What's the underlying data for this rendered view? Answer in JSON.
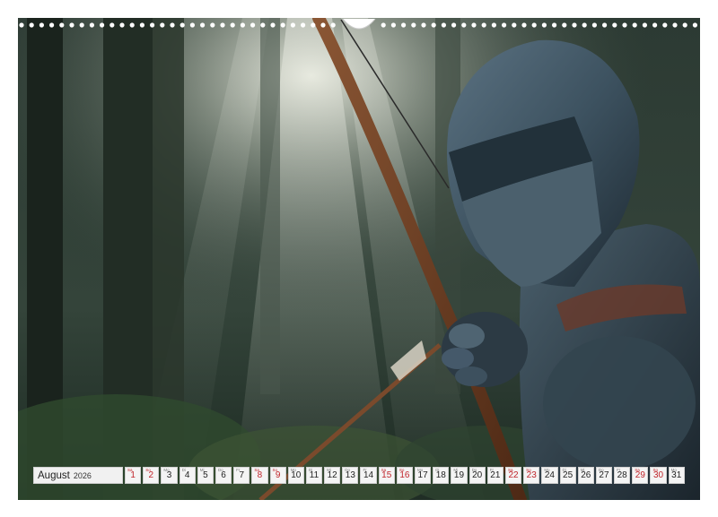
{
  "calendar": {
    "month": "August",
    "year": "2026",
    "weekend_color": "#c0262c",
    "days": [
      {
        "n": "1",
        "wd": "Sa",
        "weekend": true
      },
      {
        "n": "2",
        "wd": "So",
        "weekend": true
      },
      {
        "n": "3",
        "wd": "Mo",
        "weekend": false
      },
      {
        "n": "4",
        "wd": "Di",
        "weekend": false
      },
      {
        "n": "5",
        "wd": "Mi",
        "weekend": false
      },
      {
        "n": "6",
        "wd": "Do",
        "weekend": false
      },
      {
        "n": "7",
        "wd": "Fr",
        "weekend": false
      },
      {
        "n": "8",
        "wd": "Sa",
        "weekend": true
      },
      {
        "n": "9",
        "wd": "So",
        "weekend": true
      },
      {
        "n": "10",
        "wd": "Mo",
        "weekend": false
      },
      {
        "n": "11",
        "wd": "Di",
        "weekend": false
      },
      {
        "n": "12",
        "wd": "Mi",
        "weekend": false
      },
      {
        "n": "13",
        "wd": "Do",
        "weekend": false
      },
      {
        "n": "14",
        "wd": "Fr",
        "weekend": false
      },
      {
        "n": "15",
        "wd": "Sa",
        "weekend": true
      },
      {
        "n": "16",
        "wd": "So",
        "weekend": true
      },
      {
        "n": "17",
        "wd": "Mo",
        "weekend": false
      },
      {
        "n": "18",
        "wd": "Di",
        "weekend": false
      },
      {
        "n": "19",
        "wd": "Mi",
        "weekend": false
      },
      {
        "n": "20",
        "wd": "Do",
        "weekend": false
      },
      {
        "n": "21",
        "wd": "Fr",
        "weekend": false
      },
      {
        "n": "22",
        "wd": "Sa",
        "weekend": true
      },
      {
        "n": "23",
        "wd": "So",
        "weekend": true
      },
      {
        "n": "24",
        "wd": "Mo",
        "weekend": false
      },
      {
        "n": "25",
        "wd": "Di",
        "weekend": false
      },
      {
        "n": "26",
        "wd": "Mi",
        "weekend": false
      },
      {
        "n": "27",
        "wd": "Do",
        "weekend": false
      },
      {
        "n": "28",
        "wd": "Fr",
        "weekend": false
      },
      {
        "n": "29",
        "wd": "Sa",
        "weekend": true
      },
      {
        "n": "30",
        "wd": "So",
        "weekend": true
      },
      {
        "n": "31",
        "wd": "Mo",
        "weekend": false
      }
    ]
  },
  "photo": {
    "icon": "knight-archer-forest-photo",
    "colors": {
      "forest_dark": "#1d2a22",
      "forest_mid": "#3c4a3e",
      "light_beam": "#d9dccf",
      "armor": "#3f5563",
      "bow": "#6b3a22"
    }
  }
}
